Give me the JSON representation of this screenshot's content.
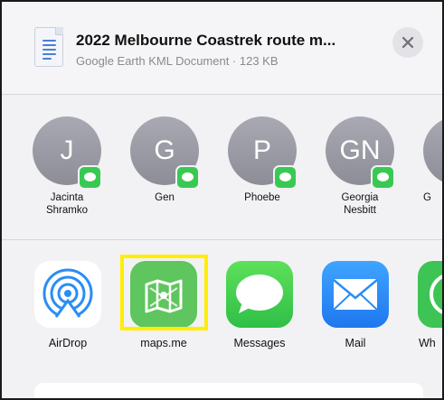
{
  "file": {
    "title": "2022 Melbourne Coastrek route m...",
    "subtitle": "Google Earth KML Document · 123 KB",
    "icon": "document-icon"
  },
  "close": {
    "icon": "close-icon"
  },
  "people": [
    {
      "initials": "J",
      "name_line1": "Jacinta",
      "name_line2": "Shramko"
    },
    {
      "initials": "G",
      "name_line1": "Gen",
      "name_line2": ""
    },
    {
      "initials": "P",
      "name_line1": "Phoebe",
      "name_line2": ""
    },
    {
      "initials": "GN",
      "name_line1": "Georgia",
      "name_line2": "Nesbitt"
    },
    {
      "initials": "",
      "name_line1": "G",
      "name_line2": ""
    }
  ],
  "apps": [
    {
      "label": "AirDrop",
      "icon": "airdrop-icon"
    },
    {
      "label": "maps.me",
      "icon": "maps-me-icon"
    },
    {
      "label": "Messages",
      "icon": "messages-icon"
    },
    {
      "label": "Mail",
      "icon": "mail-icon"
    },
    {
      "label": "Wh",
      "icon": "whatsapp-icon"
    }
  ],
  "colors": {
    "highlight": "#ffee00",
    "messages_green": "#38c953",
    "mail_blue": "#2a8df5",
    "maps_green": "#5fc55e"
  }
}
